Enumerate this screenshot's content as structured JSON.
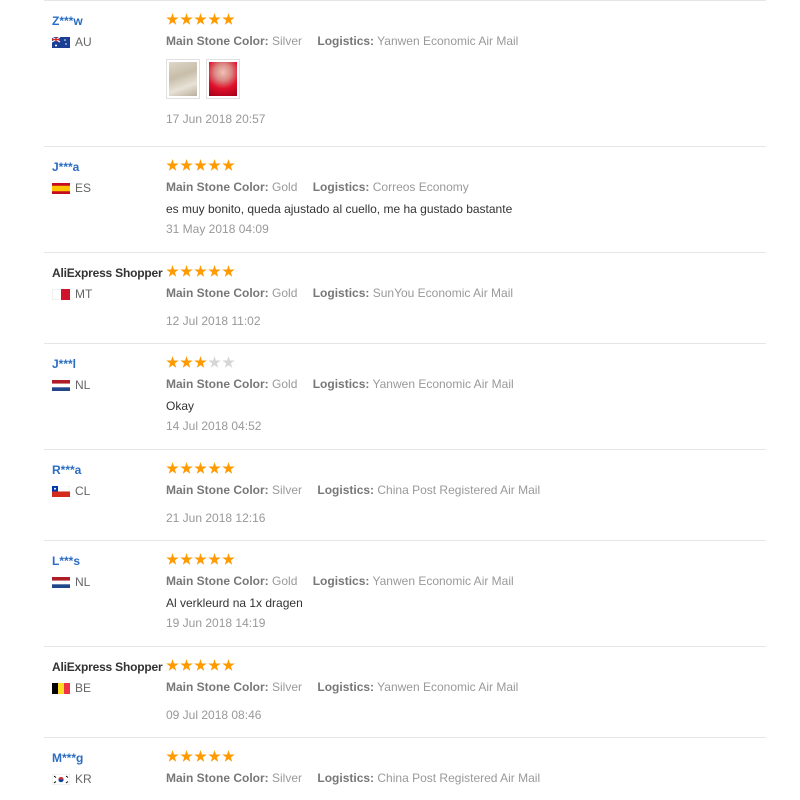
{
  "reviews": [
    {
      "user": "Z***w",
      "country": "AU",
      "rating": 5,
      "color_label": "Main Stone Color:",
      "color": "Silver",
      "logistics_label": "Logistics:",
      "logistics": "Yanwen Economic Air Mail",
      "text": "",
      "photos": 2,
      "date": "17 Jun 2018 20:57"
    },
    {
      "user": "J***a",
      "country": "ES",
      "rating": 5,
      "color_label": "Main Stone Color:",
      "color": "Gold",
      "logistics_label": "Logistics:",
      "logistics": "Correos Economy",
      "text": "es muy bonito, queda ajustado al cuello, me ha gustado bastante",
      "photos": 0,
      "date": "31 May 2018 04:09"
    },
    {
      "user": "AliExpress Shopper",
      "country": "MT",
      "rating": 5,
      "color_label": "Main Stone Color:",
      "color": "Gold",
      "logistics_label": "Logistics:",
      "logistics": "SunYou Economic Air Mail",
      "text": "",
      "photos": 0,
      "date": "12 Jul 2018 11:02"
    },
    {
      "user": "J***l",
      "country": "NL",
      "rating": 3,
      "color_label": "Main Stone Color:",
      "color": "Gold",
      "logistics_label": "Logistics:",
      "logistics": "Yanwen Economic Air Mail",
      "text": "Okay",
      "photos": 0,
      "date": "14 Jul 2018 04:52"
    },
    {
      "user": "R***a",
      "country": "CL",
      "rating": 5,
      "color_label": "Main Stone Color:",
      "color": "Silver",
      "logistics_label": "Logistics:",
      "logistics": "China Post Registered Air Mail",
      "text": "",
      "photos": 0,
      "date": "21 Jun 2018 12:16"
    },
    {
      "user": "L***s",
      "country": "NL",
      "rating": 5,
      "color_label": "Main Stone Color:",
      "color": "Gold",
      "logistics_label": "Logistics:",
      "logistics": "Yanwen Economic Air Mail",
      "text": "Al verkleurd na 1x dragen",
      "photos": 0,
      "date": "19 Jun 2018 14:19"
    },
    {
      "user": "AliExpress Shopper",
      "country": "BE",
      "rating": 5,
      "color_label": "Main Stone Color:",
      "color": "Silver",
      "logistics_label": "Logistics:",
      "logistics": "Yanwen Economic Air Mail",
      "text": "",
      "photos": 0,
      "date": "09 Jul 2018 08:46"
    },
    {
      "user": "M***g",
      "country": "KR",
      "rating": 5,
      "color_label": "Main Stone Color:",
      "color": "Silver",
      "logistics_label": "Logistics:",
      "logistics": "China Post Registered Air Mail",
      "text": "",
      "photos": 0,
      "date": ""
    }
  ],
  "flags": {
    "AU": "au-flag-icon",
    "ES": "es-flag-icon",
    "MT": "mt-flag-icon",
    "NL": "nl-flag-icon",
    "CL": "cl-flag-icon",
    "BE": "be-flag-icon",
    "KR": "kr-flag-icon"
  },
  "colors": {
    "star_on": "#ff9a00",
    "star_off": "#d6d6d6",
    "username": "#2a6dc2",
    "meta": "#999999"
  }
}
